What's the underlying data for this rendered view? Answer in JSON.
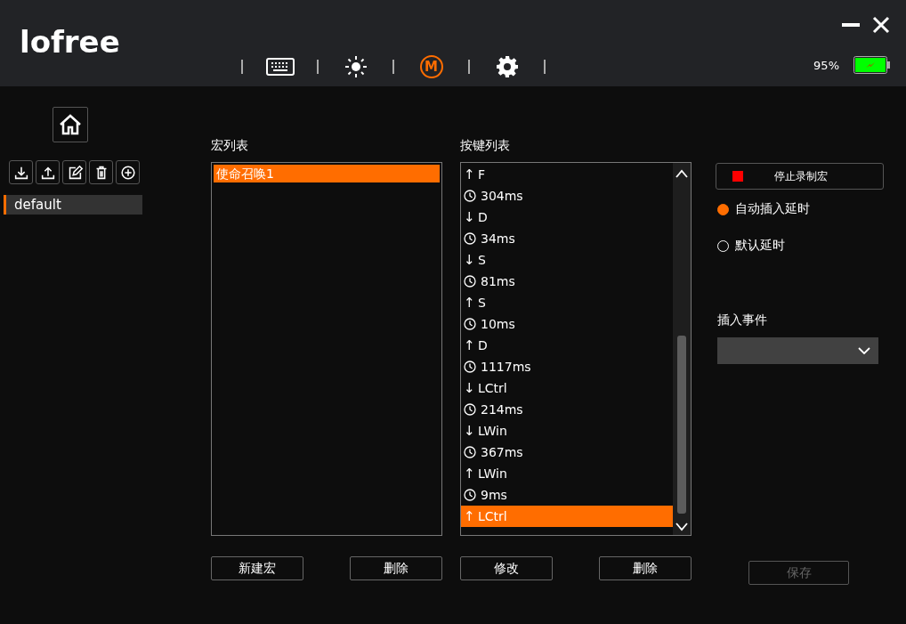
{
  "logo": "lofree",
  "nav": [
    {
      "kind": "keyboard",
      "selected": false
    },
    {
      "kind": "brightness",
      "selected": false
    },
    {
      "kind": "macro",
      "label": "M",
      "selected": true
    },
    {
      "kind": "settings",
      "selected": false
    }
  ],
  "battery": {
    "reading": "95%"
  },
  "sidebar": {
    "profiles": [
      {
        "label": "default",
        "selected": true
      }
    ]
  },
  "macro_list": {
    "title": "宏列表",
    "items": [
      {
        "label": "使命召唤1",
        "selected": true
      }
    ]
  },
  "key_list": {
    "title": "按键列表",
    "items": [
      {
        "kind": "up",
        "arrow": "↑",
        "label": "F",
        "selected": false
      },
      {
        "kind": "delay",
        "label": "304ms",
        "selected": false
      },
      {
        "kind": "down",
        "arrow": "↓",
        "label": "D",
        "selected": false
      },
      {
        "kind": "delay",
        "label": "34ms",
        "selected": false
      },
      {
        "kind": "down",
        "arrow": "↓",
        "label": "S",
        "selected": false
      },
      {
        "kind": "delay",
        "label": "81ms",
        "selected": false
      },
      {
        "kind": "up",
        "arrow": "↑",
        "label": "S",
        "selected": false
      },
      {
        "kind": "delay",
        "label": "10ms",
        "selected": false
      },
      {
        "kind": "up",
        "arrow": "↑",
        "label": "D",
        "selected": false
      },
      {
        "kind": "delay",
        "label": "1117ms",
        "selected": false
      },
      {
        "kind": "down",
        "arrow": "↓",
        "label": "LCtrl",
        "selected": false
      },
      {
        "kind": "delay",
        "label": "214ms",
        "selected": false
      },
      {
        "kind": "down",
        "arrow": "↓",
        "label": "LWin",
        "selected": false
      },
      {
        "kind": "delay",
        "label": "367ms",
        "selected": false
      },
      {
        "kind": "up",
        "arrow": "↑",
        "label": "LWin",
        "selected": false
      },
      {
        "kind": "delay",
        "label": "9ms",
        "selected": false
      },
      {
        "kind": "up",
        "arrow": "↑",
        "label": "LCtrl",
        "selected": true
      }
    ]
  },
  "record_button": {
    "label": "停止录制宏"
  },
  "delay_options": [
    {
      "label": "自动插入延时",
      "selected": true
    },
    {
      "label": "默认延时",
      "selected": false
    }
  ],
  "insert_event": {
    "label": "插入事件"
  },
  "buttons": [
    {
      "label": "新建宏",
      "disabled": false
    },
    {
      "label": "删除",
      "disabled": false
    },
    {
      "label": "修改",
      "disabled": false
    },
    {
      "label": "删除",
      "disabled": false
    },
    {
      "label": "保存",
      "disabled": true
    }
  ]
}
